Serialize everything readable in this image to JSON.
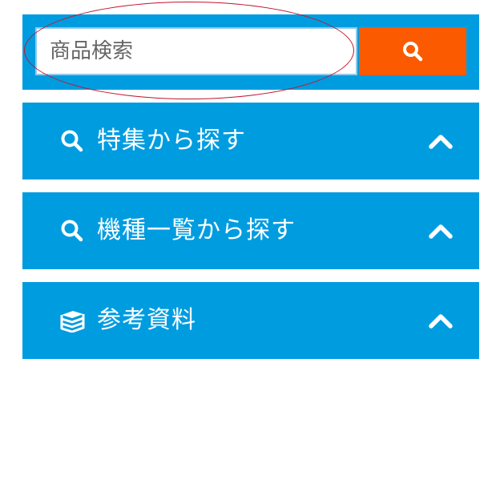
{
  "search": {
    "placeholder": "商品検索",
    "value": "",
    "button_icon": "search-icon"
  },
  "menu": {
    "items": [
      {
        "icon": "search-icon",
        "label": "特集から探す",
        "state_icon": "chevron-up-icon"
      },
      {
        "icon": "search-icon",
        "label": "機種一覧から探す",
        "state_icon": "chevron-up-icon"
      },
      {
        "icon": "books-icon",
        "label": "参考資料",
        "state_icon": "chevron-up-icon"
      }
    ]
  },
  "colors": {
    "accent_blue": "#009ce0",
    "search_button_orange": "#fb5a00",
    "annotation_red": "#c4142b"
  }
}
